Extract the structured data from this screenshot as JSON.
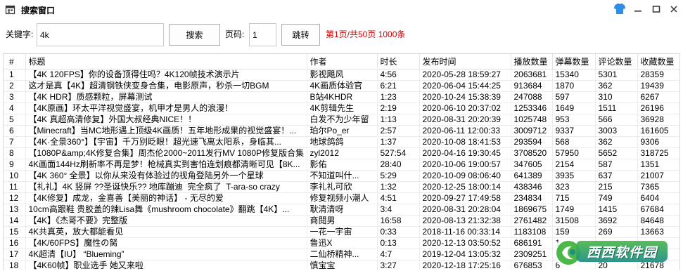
{
  "window": {
    "title": "搜索窗口",
    "icons": {
      "app": "search-window-icon",
      "skin": "skin-shirt-icon",
      "minimize": "minimize-icon",
      "maximize": "maximize-icon",
      "close": "close-icon"
    }
  },
  "toolbar": {
    "keyword_label": "关键字:",
    "keyword_value": "4k",
    "search_label": "搜索",
    "page_label": "页码:",
    "page_value": "1",
    "jump_label": "跳转",
    "page_info": "第1页/共50页 1000条"
  },
  "table": {
    "columns": [
      {
        "key": "no",
        "label": "#"
      },
      {
        "key": "title",
        "label": "标题"
      },
      {
        "key": "author",
        "label": "作者"
      },
      {
        "key": "duration",
        "label": "时长"
      },
      {
        "key": "published",
        "label": "发布时间"
      },
      {
        "key": "plays",
        "label": "播放数量"
      },
      {
        "key": "danmaku",
        "label": "弹幕数量"
      },
      {
        "key": "comments",
        "label": "评论数量"
      },
      {
        "key": "favorites",
        "label": "收藏数量"
      }
    ],
    "rows": [
      {
        "no": "1",
        "title": "【4K 120FPS】你的设备顶得住吗？4K120帧技术演示片",
        "author": "影视飓风",
        "duration": "4:56",
        "published": "2020-05-28 18:59:27",
        "plays": "2063681",
        "danmaku": "15340",
        "comments": "5301",
        "favorites": "28359"
      },
      {
        "no": "2",
        "title": "这才是真【4K】超清钢铁侠变身合集，电影原声，秒杀一切BGM",
        "author": "4K画质体验官",
        "duration": "6:21",
        "published": "2020-06-04 15:44:25",
        "plays": "913684",
        "danmaku": "1870",
        "comments": "362",
        "favorites": "19439"
      },
      {
        "no": "3",
        "title": "【4K HDR】质感颗粒，屏幕测试",
        "author": "B站4KHDR",
        "duration": "1:23",
        "published": "2020-10-24 15:38:39",
        "plays": "247088",
        "danmaku": "597",
        "comments": "310",
        "favorites": "6267"
      },
      {
        "no": "4",
        "title": "【4K原画】环太平洋视觉盛宴，机甲才是男人的浪漫！",
        "author": "4K剪辑先生",
        "duration": "2:19",
        "published": "2020-06-10 20:37:02",
        "plays": "1253346",
        "danmaku": "1649",
        "comments": "1511",
        "favorites": "26196"
      },
      {
        "no": "5",
        "title": "【4K 真超高清修复】外国大叔经典NICE！！",
        "author": "白发不为少年留",
        "duration": "1:13",
        "published": "2020-08-31 20:20:39",
        "plays": "1025748",
        "danmaku": "953",
        "comments": "566",
        "favorites": "36928"
      },
      {
        "no": "6",
        "title": "【Minecraft】当MC地形遇上顶级4K画质！五年地形成果的视觉盛宴！...",
        "author": "珀尔Po_er",
        "duration": "2:57",
        "published": "2020-06-11 12:00:33",
        "plays": "3009712",
        "danmaku": "9337",
        "comments": "3003",
        "favorites": "161605"
      },
      {
        "no": "7",
        "title": "【4K·全景360°】【宇宙】千万别眨眼！超光速飞离太阳系，身临其...",
        "author": "地球鸽鸽",
        "duration": "1:37",
        "published": "2020-10-08 18:41:53",
        "plays": "293594",
        "danmaku": "568",
        "comments": "362",
        "favorites": "9306"
      },
      {
        "no": "8",
        "title": "【1080P&amp;4K修复合集】周杰伦2000~2011发行MV 1080P修复版合集",
        "author": "zyl2012",
        "duration": "527:54",
        "published": "2020-04-16 19:30:45",
        "plays": "3708520",
        "danmaku": "57950",
        "comments": "5652",
        "favorites": "318725"
      },
      {
        "no": "9",
        "title": "4K画面144Hz刷新率不再是梦！枪械真实到害怕连划痕都清晰可见【8K...",
        "author": "影佑",
        "duration": "28:40",
        "published": "2020-10-06 19:00:57",
        "plays": "347605",
        "danmaku": "2154",
        "comments": "587",
        "favorites": "1351"
      },
      {
        "no": "10",
        "title": "【4K 360° 全景】以你从来没有体验过的视角登陆另外一个星球",
        "author": "不知道叫什...",
        "duration": "5:29",
        "published": "2020-10-09 08:06:40",
        "plays": "641389",
        "danmaku": "3935",
        "comments": "637",
        "favorites": "21007"
      },
      {
        "no": "11",
        "title": "【礼礼】4K 竖屏 ??圣诞快乐?? 地库蹦迪  完全疯了  T-ara-so crazy",
        "author": "李礼礼可欣",
        "duration": "1:32",
        "published": "2020-12-25 18:00:14",
        "plays": "438346",
        "danmaku": "323",
        "comments": "215",
        "favorites": "7365"
      },
      {
        "no": "12",
        "title": "【4K修复】成龙，金喜善【美丽的神话】 - 无尽的爱",
        "author": "修复视频小潮人",
        "duration": "4:51",
        "published": "2020-09-27 17:49:58",
        "plays": "234834",
        "danmaku": "715",
        "comments": "749",
        "favorites": "6404"
      },
      {
        "no": "13",
        "title": "10cm高跟鞋 贵胶盖的辣Lisa舞《mushroom chocolate》翻跳【4K】...",
        "author": "耿清清呀",
        "duration": "3:4",
        "published": "2020-08-31 20:28:04",
        "plays": "1869675",
        "danmaku": "1749",
        "comments": "1415",
        "favorites": "67684"
      },
      {
        "no": "14",
        "title": "【4K】《杰哥不要》完整版",
        "author": "商閱男",
        "duration": "16:58",
        "published": "2020-08-13 21:32:38",
        "plays": "2761482",
        "danmaku": "31508",
        "comments": "3692",
        "favorites": "84648"
      },
      {
        "no": "15",
        "title": "4K共真英，放大都能看见",
        "author": "一花一宇宙",
        "duration": "0:33",
        "published": "2018-11-16 00:33:14",
        "plays": "1183108",
        "danmaku": "159",
        "comments": "269",
        "favorites": "13663"
      },
      {
        "no": "16",
        "title": "【4K/60FPS】魔性の胬",
        "author": "鲁迅X",
        "duration": "0:13",
        "published": "2020-12-13 03:50:52",
        "plays": "686191",
        "danmaku": "1",
        "comments": "",
        "favorites": ""
      },
      {
        "no": "17",
        "title": "4K超清【IU】 “Blueming”",
        "author": "二仙桥精神...",
        "duration": "4:7",
        "published": "2019-12-04 13:05:32",
        "plays": "2309251",
        "danmaku": "",
        "comments": "",
        "favorites": ""
      },
      {
        "no": "18",
        "title": "【4K60帧】职业选手 她又来啦",
        "author": "慎宝宝",
        "duration": "3:27",
        "published": "2020-12-18 17:25:16",
        "plays": "676853",
        "danmaku": "6",
        "comments": "20",
        "favorites": "21678"
      }
    ]
  },
  "watermark": {
    "text": "西西软件园",
    "logo_icon": "xixi-logo-icon"
  },
  "colors": {
    "page_info_red": "#cc0000",
    "skin_icon_blue": "#2f8ee6",
    "watermark_green": "#4cb84a",
    "watermark_teal": "#1f8f86"
  }
}
